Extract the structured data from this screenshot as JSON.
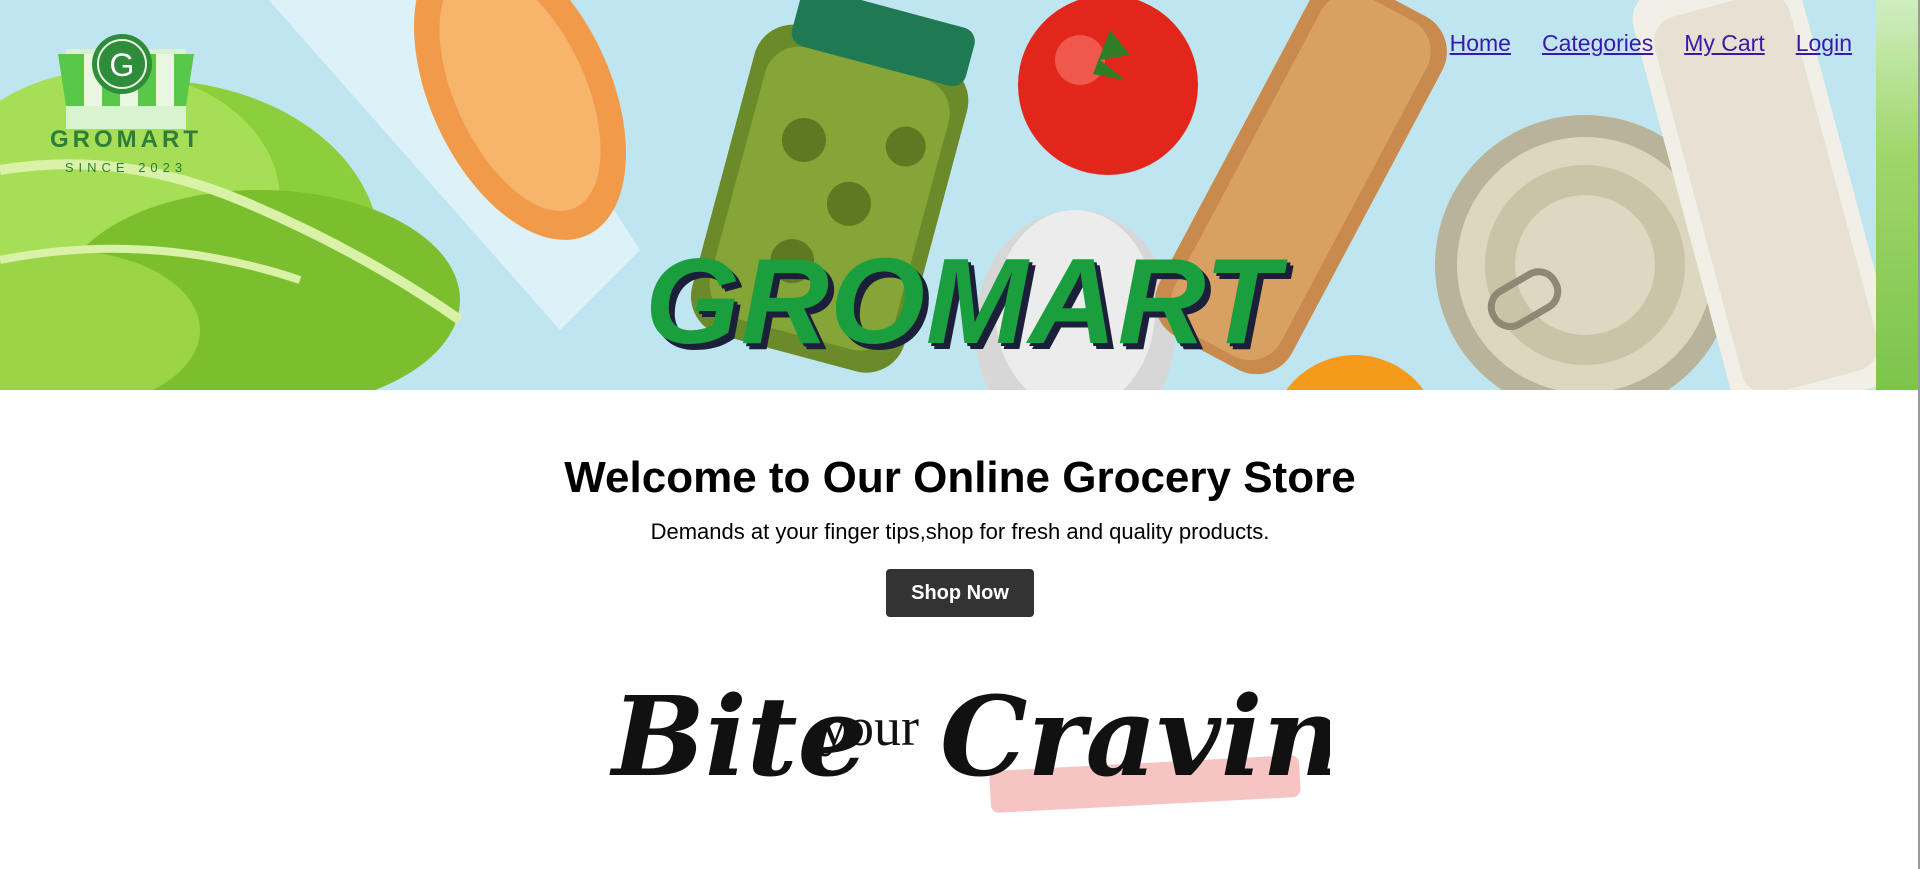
{
  "brand": {
    "logo_letter": "G",
    "logo_name": "GROMART",
    "logo_since": "SINCE 2023",
    "hero_title": "GROMART"
  },
  "nav": {
    "items": [
      {
        "label": "Home"
      },
      {
        "label": "Categories"
      },
      {
        "label": "My Cart"
      },
      {
        "label": "Login"
      }
    ]
  },
  "main": {
    "heading": "Welcome to Our Online Grocery Store",
    "tagline": "Demands at your finger tips,shop for fresh and quality products.",
    "cta_label": "Shop Now"
  },
  "slogan": {
    "word1": "Bite",
    "word2": "your",
    "word3": "Cravings"
  },
  "colors": {
    "brand_green": "#1a9f3e",
    "link": "#3a19a8",
    "button_bg": "#333333",
    "hero_bg": "#bfe6f0"
  }
}
